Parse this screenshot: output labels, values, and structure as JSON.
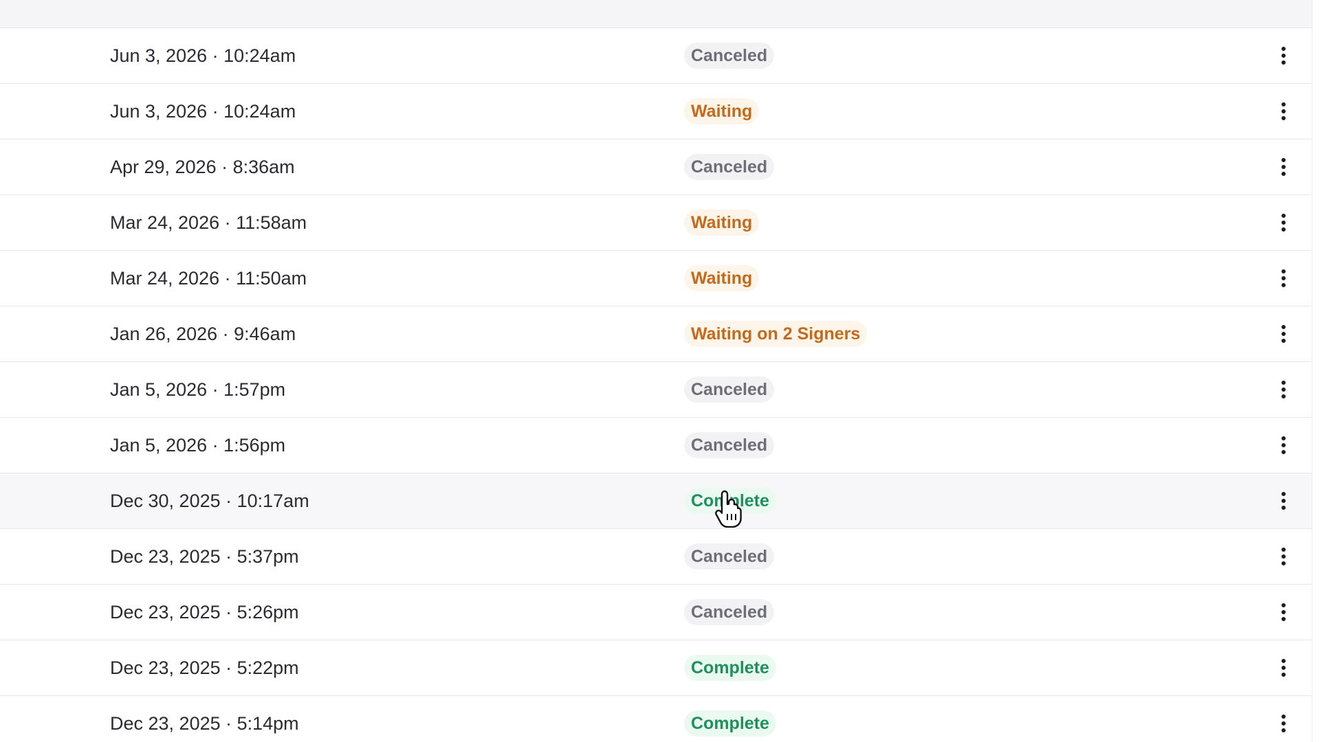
{
  "rows": [
    {
      "date": "Jun 3, 2026 · 10:24am",
      "status": "Canceled",
      "status_type": "canceled"
    },
    {
      "date": "Jun 3, 2026 · 10:24am",
      "status": "Waiting",
      "status_type": "waiting"
    },
    {
      "date": "Apr 29, 2026 · 8:36am",
      "status": "Canceled",
      "status_type": "canceled"
    },
    {
      "date": "Mar 24, 2026 · 11:58am",
      "status": "Waiting",
      "status_type": "waiting"
    },
    {
      "date": "Mar 24, 2026 · 11:50am",
      "status": "Waiting",
      "status_type": "waiting"
    },
    {
      "date": "Jan 26, 2026 · 9:46am",
      "status": "Waiting on 2 Signers",
      "status_type": "waiting"
    },
    {
      "date": "Jan 5, 2026 · 1:57pm",
      "status": "Canceled",
      "status_type": "canceled"
    },
    {
      "date": "Jan 5, 2026 · 1:56pm",
      "status": "Canceled",
      "status_type": "canceled"
    },
    {
      "date": "Dec 30, 2025 · 10:17am",
      "status": "Complete",
      "status_type": "complete",
      "hovered": true
    },
    {
      "date": "Dec 23, 2025 · 5:37pm",
      "status": "Canceled",
      "status_type": "canceled"
    },
    {
      "date": "Dec 23, 2025 · 5:26pm",
      "status": "Canceled",
      "status_type": "canceled"
    },
    {
      "date": "Dec 23, 2025 · 5:22pm",
      "status": "Complete",
      "status_type": "complete"
    },
    {
      "date": "Dec 23, 2025 · 5:14pm",
      "status": "Complete",
      "status_type": "complete"
    }
  ],
  "icons": {
    "row_menu": "more-vertical-icon",
    "cursor": "hand-pointer-cursor-icon"
  },
  "colors": {
    "canceled_text": "#6e6e78",
    "canceled_bg": "#f2f2f4",
    "waiting_text": "#c46a1c",
    "waiting_bg": "#fdf4ea",
    "complete_text": "#1f8f5c",
    "complete_bg": "#eafaf1"
  }
}
